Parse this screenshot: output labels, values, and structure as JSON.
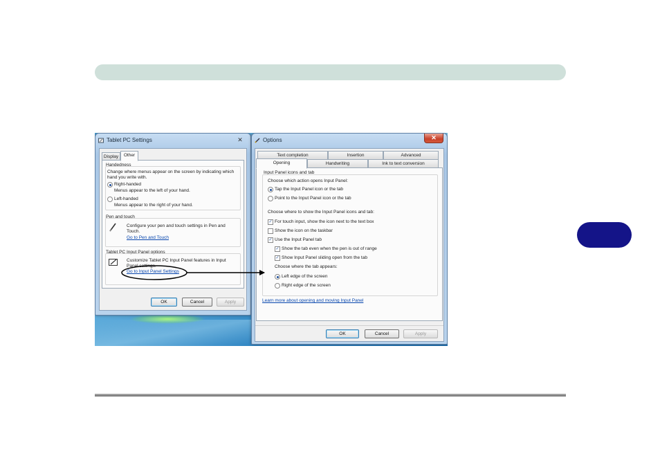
{
  "colors": {
    "top_bar": "#cfe0da",
    "chapter_tab": "#141488",
    "link": "#0645ad"
  },
  "tablet_settings": {
    "title": "Tablet PC Settings",
    "close_glyph": "✕",
    "tabs": [
      "Display",
      "Other"
    ],
    "handedness": {
      "label": "Handedness",
      "desc_line1": "Change where menus appear on the screen by indicating which",
      "desc_line2": "hand you write with.",
      "right_label": "Right-handed",
      "right_desc": "Menus appear to the left of your hand.",
      "left_label": "Left-handed",
      "left_desc": "Menus appear to the right of your hand."
    },
    "pen": {
      "label": "Pen and touch",
      "desc_line1": "Configure your pen and touch settings in Pen and",
      "desc_line2": "Touch.",
      "link": "Go to Pen and Touch"
    },
    "input_panel": {
      "label": "Tablet PC Input Panel options",
      "desc_line1": "Customize Tablet PC Input Panel features in Input",
      "desc_line2": "Panel settings.",
      "link": "Go to Input Panel Settings"
    },
    "ok": "OK",
    "cancel": "Cancel",
    "apply": "Apply"
  },
  "options": {
    "title": "Options",
    "close_glyph": "✕",
    "tabs_row1": [
      "Text completion",
      "Insertion",
      "Advanced"
    ],
    "tabs_row2": [
      "Opening",
      "Handwriting",
      "Ink to text conversion"
    ],
    "group_label": "Input Panel icons and tab",
    "action_heading": "Choose which action opens Input Panel:",
    "tap_option": "Tap the Input Panel icon or the tab",
    "point_option": "Point to the Input Panel icon or the tab",
    "where_heading": "Choose where to show the Input Panel icons and tab:",
    "touch_option": "For touch input, show the icon next to the text box",
    "taskbar_option": "Show the icon on the taskbar",
    "use_tab_option": "Use the Input Panel tab",
    "out_of_range_option": "Show the tab even when the pen is out of range",
    "sliding_option": "Show Input Panel sliding open from the tab",
    "tab_appears_heading": "Choose where the tab appears:",
    "left_edge": "Left edge of the screen",
    "right_edge": "Right edge of the screen",
    "learn_link": "Learn more about opening and moving Input Panel",
    "ok": "OK",
    "cancel": "Cancel",
    "apply": "Apply"
  }
}
